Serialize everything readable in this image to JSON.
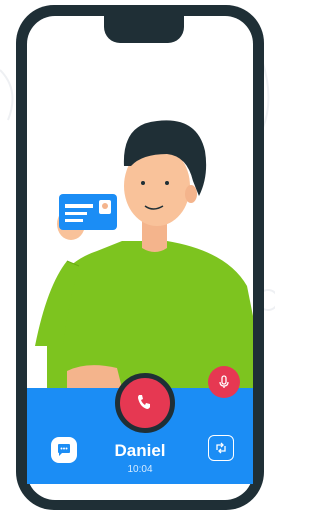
{
  "call": {
    "caller_name": "Daniel",
    "duration": "10:04"
  },
  "icons": {
    "end_call": "phone-hangup-icon",
    "mic": "microphone-icon",
    "chat": "chat-bubble-icon",
    "switch_camera": "switch-camera-icon"
  },
  "colors": {
    "panel_blue": "#1b8df5",
    "end_call_red": "#e63852",
    "phone_frame": "#1f2f36",
    "shirt_green": "#7dc41f"
  }
}
